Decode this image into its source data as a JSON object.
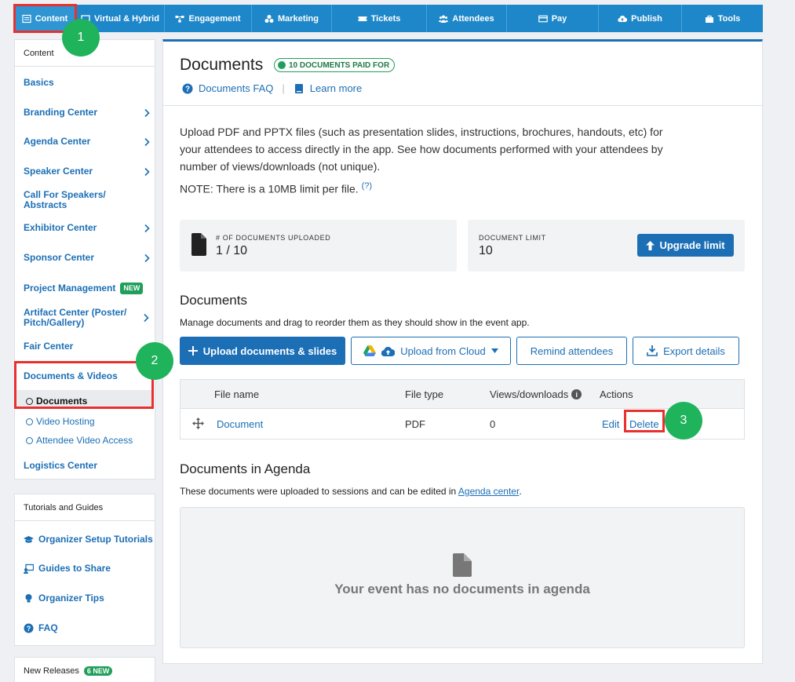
{
  "nav": {
    "tabs": [
      {
        "label": "Content",
        "icon": "content-icon"
      },
      {
        "label": "Virtual & Hybrid",
        "icon": "monitor-icon"
      },
      {
        "label": "Engagement",
        "icon": "engagement-icon"
      },
      {
        "label": "Marketing",
        "icon": "marketing-icon"
      },
      {
        "label": "Tickets",
        "icon": "ticket-icon"
      },
      {
        "label": "Attendees",
        "icon": "people-icon"
      },
      {
        "label": "Pay",
        "icon": "card-icon"
      },
      {
        "label": "Publish",
        "icon": "cloud-upload-icon"
      },
      {
        "label": "Tools",
        "icon": "toolbox-icon"
      }
    ]
  },
  "annotations": [
    "1",
    "2",
    "3"
  ],
  "sidebar": {
    "header": "Content",
    "items": [
      {
        "label": "Basics"
      },
      {
        "label": "Branding Center"
      },
      {
        "label": "Agenda Center"
      },
      {
        "label": "Speaker Center"
      },
      {
        "label": "Call For Speakers/ Abstracts"
      },
      {
        "label": "Exhibitor Center"
      },
      {
        "label": "Sponsor Center"
      },
      {
        "label": "Project Management",
        "badge": "NEW"
      },
      {
        "label": "Artifact Center (Poster/ Pitch/Gallery)"
      },
      {
        "label": "Fair Center"
      },
      {
        "label": "Documents & Videos"
      },
      {
        "label": "Logistics Center"
      }
    ],
    "subitems": [
      {
        "label": "Documents"
      },
      {
        "label": "Video Hosting"
      },
      {
        "label": "Attendee Video Access"
      }
    ]
  },
  "tutorials": {
    "header": "Tutorials and Guides",
    "items": [
      {
        "label": "Organizer Setup Tutorials",
        "icon": "graduation-cap-icon"
      },
      {
        "label": "Guides to Share",
        "icon": "share-screen-icon"
      },
      {
        "label": "Organizer Tips",
        "icon": "lightbulb-icon"
      },
      {
        "label": "FAQ",
        "icon": "question-circle-icon"
      }
    ]
  },
  "releases": {
    "header": "New Releases",
    "badge": "6 NEW"
  },
  "main": {
    "title": "Documents",
    "paid_badge": "10 DOCUMENTS PAID FOR",
    "faq_link": "Documents FAQ",
    "learn_link": "Learn more",
    "description": "Upload PDF and PPTX files (such as presentation slides, instructions, brochures, handouts, etc) for your attendees to access directly in the app. See how documents performed with your attendees by number of views/downloads (not unique).",
    "note": "NOTE: There is a 10MB limit per file.",
    "note_help": "(?)",
    "stats": {
      "uploaded_label": "# OF DOCUMENTS UPLOADED",
      "uploaded_value": "1 / 10",
      "limit_label": "DOCUMENT LIMIT",
      "limit_value": "10",
      "upgrade_button": "Upgrade limit"
    },
    "documents_heading": "Documents",
    "documents_sub": "Manage documents and drag to reorder them as they should show in the event app.",
    "buttons": {
      "upload": "Upload documents & slides",
      "cloud": "Upload from Cloud",
      "remind": "Remind attendees",
      "export": "Export details"
    },
    "table": {
      "headers": [
        "File name",
        "File type",
        "Views/downloads",
        "Actions"
      ],
      "rows": [
        {
          "name": "Document",
          "type": "PDF",
          "views": "0",
          "edit": "Edit",
          "delete": "Delete"
        }
      ]
    },
    "agenda_heading": "Documents in Agenda",
    "agenda_sub_prefix": "These documents were uploaded to sessions and can be edited in",
    "agenda_link": "Agenda center",
    "agenda_sub_suffix": ".",
    "empty_message": "Your event has no documents in agenda"
  },
  "colors": {
    "accent": "#1c6fb5",
    "nav": "#1e87c9",
    "success": "#1f9f5a",
    "highlight": "#e8312f"
  }
}
